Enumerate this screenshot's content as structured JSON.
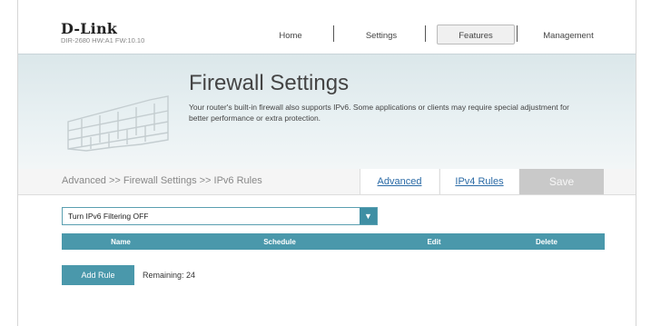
{
  "header": {
    "logo": "D-Link",
    "model": "DIR-2680 HW:A1 FW:10.10",
    "nav": [
      {
        "label": "Home"
      },
      {
        "label": "Settings"
      },
      {
        "label": "Features"
      },
      {
        "label": "Management"
      }
    ],
    "active_nav": "Features"
  },
  "banner": {
    "title": "Firewall Settings",
    "description": "Your router's built-in firewall also supports IPv6. Some applications or clients may require special adjustment for better performance or extra protection.",
    "icon": "brick-wall-icon"
  },
  "subbar": {
    "breadcrumb": "Advanced >> Firewall Settings >> IPv6 Rules",
    "tabs": [
      {
        "label": "Advanced"
      },
      {
        "label": "IPv4 Rules"
      }
    ],
    "save_label": "Save"
  },
  "filter": {
    "selected": "Turn IPv6 Filtering OFF",
    "icon": "chevron-down-icon"
  },
  "table": {
    "columns": [
      "Name",
      "Schedule",
      "Edit",
      "Delete"
    ]
  },
  "actions": {
    "add_rule_label": "Add Rule",
    "remaining_text": "Remaining: 24"
  },
  "colors": {
    "accent": "#4a98ab",
    "link": "#2a6aa6",
    "save_disabled": "#c9c9c9"
  }
}
